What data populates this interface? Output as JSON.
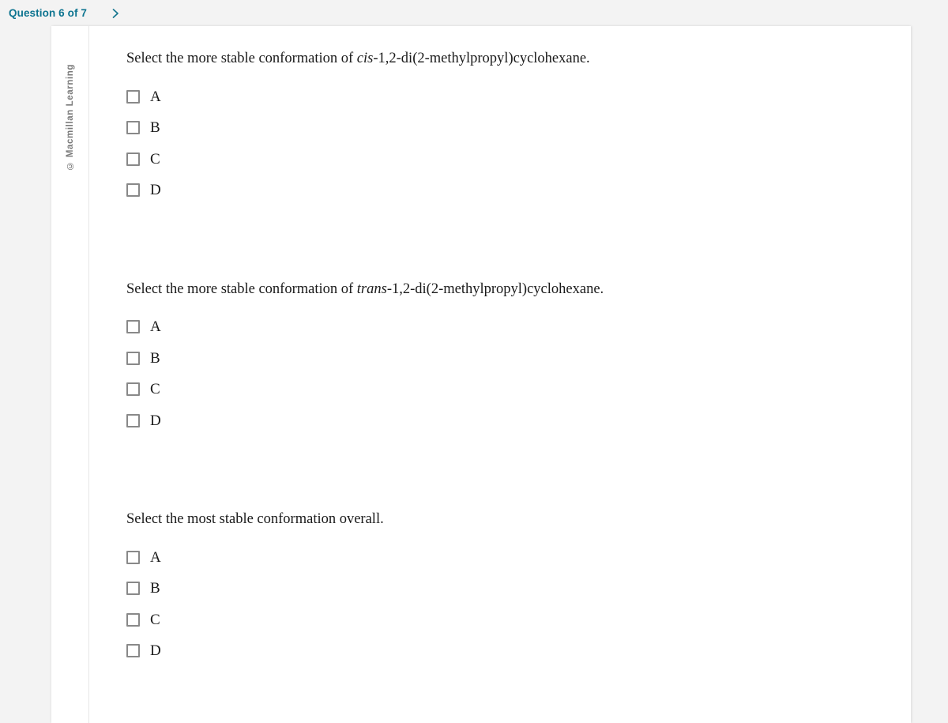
{
  "header": {
    "question_counter": "Question 6 of 7",
    "next_icon": "chevron-right-icon",
    "accent_color": "#0d7490"
  },
  "sidebar": {
    "copyright": "© Macmillan Learning"
  },
  "card": {
    "background_color": "#ffffff"
  },
  "questions": [
    {
      "prompt_pre": "Select the more stable conformation of ",
      "prompt_italic": "cis",
      "prompt_post": "-1,2-di(2-methylpropyl)cyclohexane.",
      "options": [
        {
          "label": "A",
          "checked": false
        },
        {
          "label": "B",
          "checked": false
        },
        {
          "label": "C",
          "checked": false
        },
        {
          "label": "D",
          "checked": false
        }
      ]
    },
    {
      "prompt_pre": "Select the more stable conformation of ",
      "prompt_italic": "trans",
      "prompt_post": "-1,2-di(2-methylpropyl)cyclohexane.",
      "options": [
        {
          "label": "A",
          "checked": false
        },
        {
          "label": "B",
          "checked": false
        },
        {
          "label": "C",
          "checked": false
        },
        {
          "label": "D",
          "checked": false
        }
      ]
    },
    {
      "prompt_pre": "Select the most stable conformation overall.",
      "prompt_italic": "",
      "prompt_post": "",
      "options": [
        {
          "label": "A",
          "checked": false
        },
        {
          "label": "B",
          "checked": false
        },
        {
          "label": "C",
          "checked": false
        },
        {
          "label": "D",
          "checked": false
        }
      ]
    }
  ]
}
